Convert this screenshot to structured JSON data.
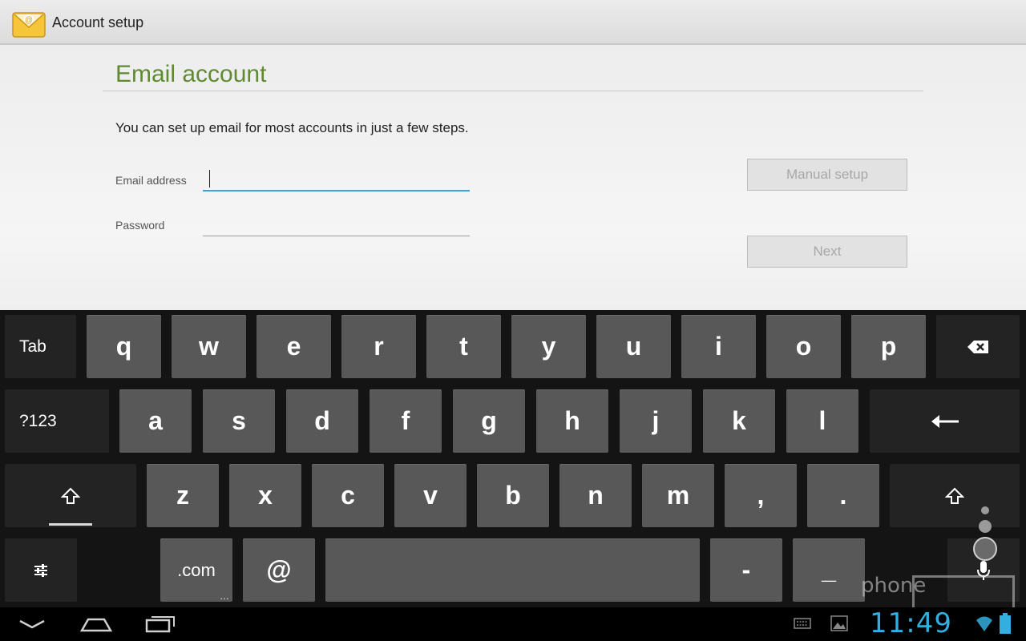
{
  "actionbar": {
    "title": "Account setup",
    "icon": "email-app-icon"
  },
  "content": {
    "section_title": "Email account",
    "intro": "You can set up email for most accounts in just a few steps.",
    "email_label": "Email address",
    "email_value": "",
    "password_label": "Password",
    "password_value": "",
    "manual_setup_label": "Manual setup",
    "next_label": "Next"
  },
  "keyboard": {
    "row1": [
      "q",
      "w",
      "e",
      "r",
      "t",
      "y",
      "u",
      "i",
      "o",
      "p"
    ],
    "row2": [
      "a",
      "s",
      "d",
      "f",
      "g",
      "h",
      "j",
      "k",
      "l"
    ],
    "row3": [
      "z",
      "x",
      "c",
      "v",
      "b",
      "n",
      "m",
      ",",
      "."
    ],
    "tab_label": "Tab",
    "symbols_label": "?123",
    "com_label": ".com",
    "at_label": "@",
    "dash_label": "-",
    "underscore_label": "_",
    "icons": {
      "backspace": "backspace-icon",
      "enter": "enter-icon",
      "shift": "shift-icon",
      "settings": "settings-icon",
      "mic": "mic-icon"
    }
  },
  "statusbar": {
    "clock": "11:49",
    "icons": [
      "back-icon",
      "home-icon",
      "recent-apps-icon",
      "keyboard-icon",
      "gallery-icon",
      "wifi-icon",
      "battery-icon"
    ]
  },
  "watermark": {
    "text": "phone"
  },
  "colors": {
    "title_green": "#5f8a31",
    "focus_blue": "#3aa3dc",
    "clock_blue": "#33aee0",
    "key_gray": "#585858",
    "key_fn": "#232323"
  }
}
